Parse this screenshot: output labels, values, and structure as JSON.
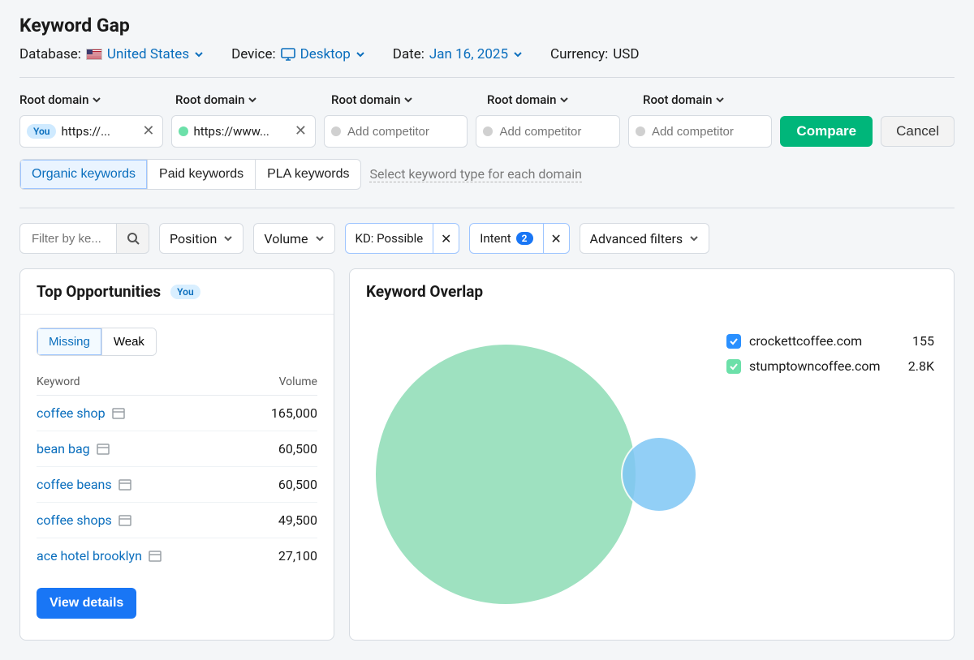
{
  "page_title": "Keyword Gap",
  "meta": {
    "database_label": "Database:",
    "database_value": "United States",
    "device_label": "Device:",
    "device_value": "Desktop",
    "date_label": "Date:",
    "date_value": "Jan 16, 2025",
    "currency_label": "Currency:",
    "currency_value": "USD"
  },
  "domain_section": {
    "label": "Root domain",
    "you_label": "You",
    "inputs": [
      {
        "you": true,
        "value": "https://..."
      },
      {
        "you": false,
        "value": "https://www...",
        "dot": "green"
      },
      {
        "you": false,
        "value": "",
        "placeholder": "Add competitor"
      },
      {
        "you": false,
        "value": "",
        "placeholder": "Add competitor"
      },
      {
        "you": false,
        "value": "",
        "placeholder": "Add competitor"
      }
    ],
    "compare": "Compare",
    "cancel": "Cancel"
  },
  "kw_types": {
    "organic": "Organic keywords",
    "paid": "Paid keywords",
    "pla": "PLA keywords",
    "select_each": "Select keyword type for each domain"
  },
  "filters": {
    "filter_placeholder": "Filter by ke...",
    "position": "Position",
    "volume": "Volume",
    "kd": "KD: Possible",
    "intent": "Intent",
    "intent_count": "2",
    "advanced": "Advanced filters"
  },
  "opportunities": {
    "title": "Top Opportunities",
    "you_label": "You",
    "tabs": {
      "missing": "Missing",
      "weak": "Weak"
    },
    "col_keyword": "Keyword",
    "col_volume": "Volume",
    "rows": [
      {
        "keyword": "coffee shop",
        "volume": "165,000"
      },
      {
        "keyword": "bean bag",
        "volume": "60,500"
      },
      {
        "keyword": "coffee beans",
        "volume": "60,500"
      },
      {
        "keyword": "coffee shops",
        "volume": "49,500"
      },
      {
        "keyword": "ace hotel brooklyn",
        "volume": "27,100"
      }
    ],
    "view_details": "View details"
  },
  "overlap": {
    "title": "Keyword Overlap",
    "legend": [
      {
        "color": "blue",
        "domain": "crockettcoffee.com",
        "count": "155"
      },
      {
        "color": "green",
        "domain": "stumptowncoffee.com",
        "count": "2.8K"
      }
    ]
  }
}
